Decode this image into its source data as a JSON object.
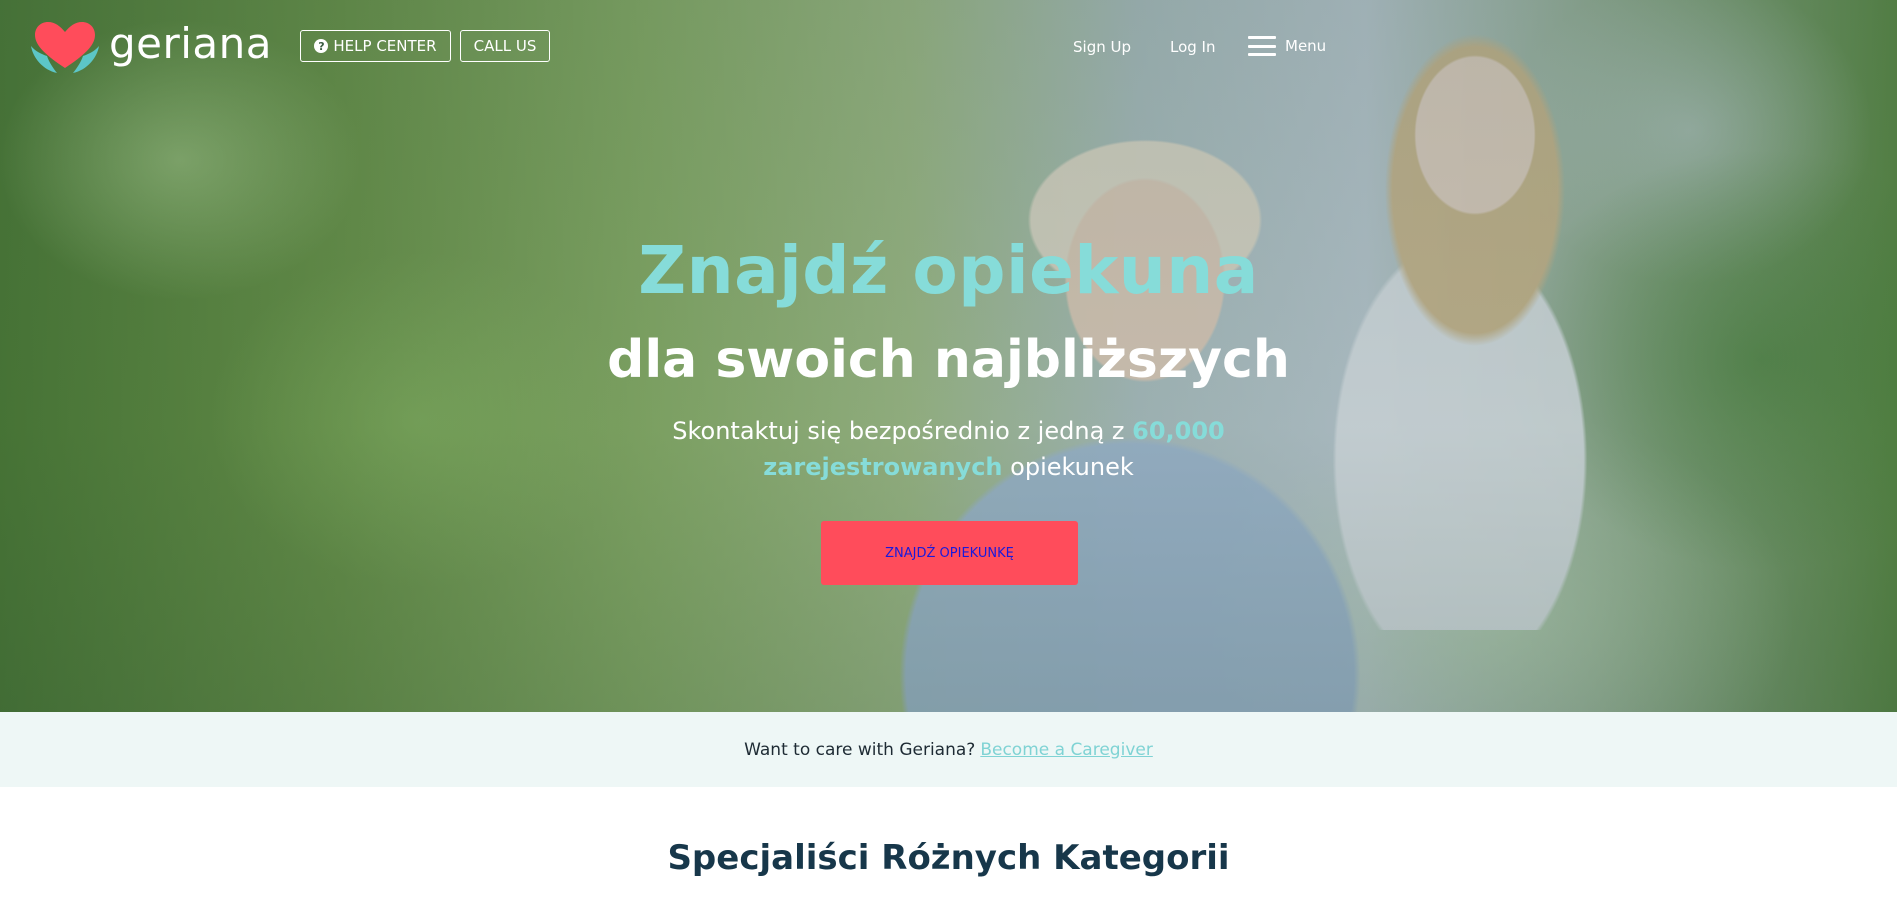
{
  "brand": {
    "name": "geriana",
    "logo_icon": "heart-hands-icon",
    "heart_color": "#ff4c5b",
    "hands_color": "#5cc6c7"
  },
  "nav": {
    "help_center": "HELP CENTER",
    "help_icon": "question-circle-icon",
    "call_us": "CALL US",
    "sign_up": "Sign Up",
    "log_in": "Log In",
    "menu": "Menu",
    "menu_icon": "hamburger-icon"
  },
  "hero": {
    "title": "Znajdź opiekuna",
    "subtitle": "dla swoich najbliższych",
    "desc_before": "Skontaktuj się bezpośrednio z jedną z ",
    "desc_highlight": "60,000 zarejestrowanych",
    "desc_after": " opiekunek",
    "cta": "ZNAJDŹ OPIEKUNKĘ"
  },
  "band": {
    "text": "Want to care with Geriana?",
    "link": "Become a Caregiver"
  },
  "section": {
    "title": "Specjaliści Różnych Kategorii"
  },
  "colors": {
    "accent_teal": "#86dcd9",
    "cta_red": "#ff4c5b",
    "band_bg": "#eef7f6",
    "heading_dark": "#17374a"
  }
}
